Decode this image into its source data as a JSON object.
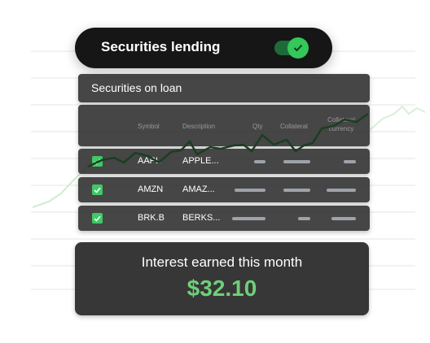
{
  "toggle": {
    "label": "Securities lending",
    "enabled": true
  },
  "loan_panel": {
    "title": "Securities on loan"
  },
  "table": {
    "headers": [
      "Symbol",
      "Description",
      "Qty",
      "Collateral",
      "Collateral currency"
    ],
    "rows": [
      {
        "checked": true,
        "symbol": "AAPL",
        "description": "APPLE..."
      },
      {
        "checked": true,
        "symbol": "AMZN",
        "description": "AMAZ..."
      },
      {
        "checked": true,
        "symbol": "BRK.B",
        "description": "BERKS..."
      }
    ]
  },
  "interest": {
    "label": "Interest earned this month",
    "amount": "$32.10"
  },
  "colors": {
    "accent": "#34c759",
    "amount": "#6fcf7a",
    "panel": "#2c2c2c"
  }
}
